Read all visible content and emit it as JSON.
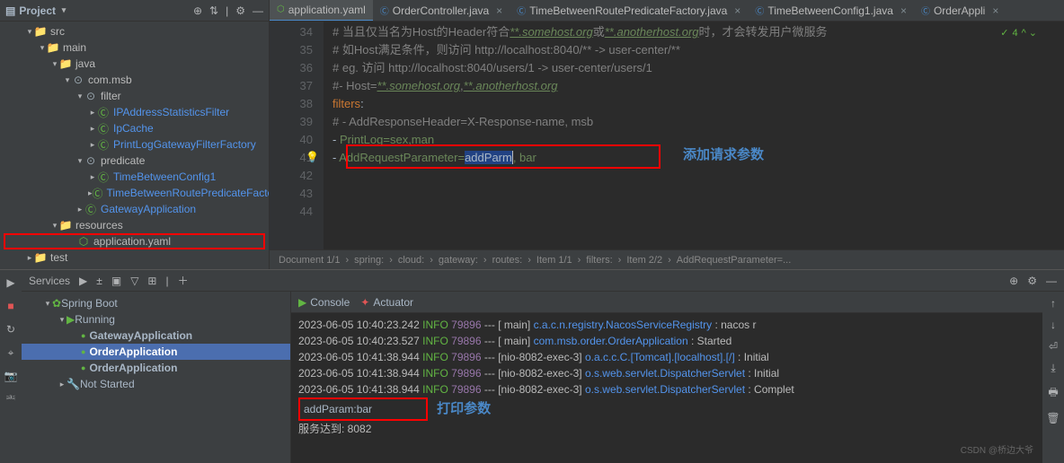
{
  "project": {
    "title": "Project",
    "tree": [
      {
        "indent": 2,
        "arrow": "▾",
        "icon": "folder",
        "label": "src"
      },
      {
        "indent": 3,
        "arrow": "▾",
        "icon": "folder",
        "label": "main"
      },
      {
        "indent": 4,
        "arrow": "▾",
        "icon": "bluefolder",
        "label": "java"
      },
      {
        "indent": 5,
        "arrow": "▾",
        "icon": "package",
        "label": "com.msb"
      },
      {
        "indent": 6,
        "arrow": "▾",
        "icon": "package",
        "label": "filter"
      },
      {
        "indent": 7,
        "arrow": "▸",
        "icon": "class",
        "label": "IPAddressStatisticsFilter"
      },
      {
        "indent": 7,
        "arrow": "▸",
        "icon": "class",
        "label": "IpCache"
      },
      {
        "indent": 7,
        "arrow": "▸",
        "icon": "class",
        "label": "PrintLogGatewayFilterFactory"
      },
      {
        "indent": 6,
        "arrow": "▾",
        "icon": "package",
        "label": "predicate"
      },
      {
        "indent": 7,
        "arrow": "▸",
        "icon": "class",
        "label": "TimeBetweenConfig1"
      },
      {
        "indent": 7,
        "arrow": "▸",
        "icon": "class",
        "label": "TimeBetweenRoutePredicateFactory"
      },
      {
        "indent": 6,
        "arrow": "▸",
        "icon": "class",
        "label": "GatewayApplication"
      },
      {
        "indent": 4,
        "arrow": "▾",
        "icon": "resfolder",
        "label": "resources"
      },
      {
        "indent": 5,
        "arrow": "",
        "icon": "yaml",
        "label": "application.yaml",
        "hl": true
      },
      {
        "indent": 2,
        "arrow": "▸",
        "icon": "folder",
        "label": "test"
      }
    ]
  },
  "tabs": [
    {
      "icon": "yaml",
      "label": "application.yaml",
      "active": true
    },
    {
      "icon": "java",
      "label": "OrderController.java"
    },
    {
      "icon": "java",
      "label": "TimeBetweenRoutePredicateFactory.java"
    },
    {
      "icon": "java",
      "label": "TimeBetweenConfig1.java"
    },
    {
      "icon": "java",
      "label": "OrderAppli"
    }
  ],
  "editor": {
    "startLine": 34,
    "lines": [
      {
        "n": 34,
        "html": "<span class='cmt'>#  当且仅当名为Host的Header符合<span class='ital'>**.somehost.org</span>或<span class='ital'>**.anotherhost.org</span>时，才会转发用户微服务</span>"
      },
      {
        "n": 35,
        "html": "<span class='cmt'>#  如Host满足条件，则访问 http://localhost:8040/** -> user-center/**</span>"
      },
      {
        "n": 36,
        "html": "<span class='cmt'>#  eg. 访问 http://localhost:8040/users/1 -> user-center/users/1</span>"
      },
      {
        "n": 37,
        "html": "<span class='cmt'>#- Host=<span class='ital'>**.somehost.org</span>,<span class='ital'>**.anotherhost.org</span></span>"
      },
      {
        "n": 38,
        "html": "      <span class='key'>filters</span>:"
      },
      {
        "n": 39,
        "html": "<span class='cmt'>#        - AddResponseHeader=X-Response-name, msb</span>"
      },
      {
        "n": 40,
        "html": "        - <span class='str'>PrintLog=sex,man</span>"
      },
      {
        "n": 41,
        "html": "        - <span class='str'>AddRequestParameter=</span><span class='sel'>addParm</span><span class='caret'></span><span class='str'>, bar</span>"
      },
      {
        "n": 42,
        "html": ""
      },
      {
        "n": 43,
        "html": ""
      },
      {
        "n": 44,
        "html": ""
      }
    ],
    "annotation1": "添加请求参数",
    "check": "4",
    "breadcrumb": [
      "Document 1/1",
      "spring:",
      "cloud:",
      "gateway:",
      "routes:",
      "Item 1/1",
      "filters:",
      "Item 2/2",
      "AddRequestParameter=..."
    ]
  },
  "services": {
    "title": "Services",
    "tree": [
      {
        "indent": 1,
        "arrow": "▾",
        "icon": "spring",
        "label": "Spring Boot"
      },
      {
        "indent": 2,
        "arrow": "▾",
        "icon": "play",
        "label": "Running",
        "bold": false
      },
      {
        "indent": 3,
        "arrow": "",
        "icon": "dot",
        "label": "GatewayApplication",
        "bold": true
      },
      {
        "indent": 3,
        "arrow": "",
        "icon": "dot",
        "label": "OrderApplication",
        "bold": true,
        "selected": true
      },
      {
        "indent": 3,
        "arrow": "",
        "icon": "dot",
        "label": "OrderApplication",
        "bold": true
      },
      {
        "indent": 2,
        "arrow": "▸",
        "icon": "wrench",
        "label": "Not Started"
      }
    ],
    "consoleTabs": {
      "console": "Console",
      "actuator": "Actuator"
    },
    "logs": [
      {
        "ts": "2023-06-05 10:40:23.242",
        "lvl": "INFO",
        "pid": "79896",
        "thr": "[           main]",
        "cls": "c.a.c.n.registry.NacosServiceRegistry",
        "msg": ": nacos r"
      },
      {
        "ts": "2023-06-05 10:40:23.527",
        "lvl": "INFO",
        "pid": "79896",
        "thr": "[           main]",
        "cls": "com.msb.order.OrderApplication",
        "msg": ": Started"
      },
      {
        "ts": "2023-06-05 10:41:38.944",
        "lvl": "INFO",
        "pid": "79896",
        "thr": "[nio-8082-exec-3]",
        "cls": "o.a.c.c.C.[Tomcat].[localhost].[/]",
        "msg": ": Initial"
      },
      {
        "ts": "2023-06-05 10:41:38.944",
        "lvl": "INFO",
        "pid": "79896",
        "thr": "[nio-8082-exec-3]",
        "cls": "o.s.web.servlet.DispatcherServlet",
        "msg": ": Initial"
      },
      {
        "ts": "2023-06-05 10:41:38.944",
        "lvl": "INFO",
        "pid": "79896",
        "thr": "[nio-8082-exec-3]",
        "cls": "o.s.web.servlet.DispatcherServlet",
        "msg": ": Complet"
      }
    ],
    "extra": "addParam:bar",
    "annotation2": "打印参数",
    "footer": "服务达到: 8082",
    "watermark": "CSDN @桥边大爷"
  }
}
